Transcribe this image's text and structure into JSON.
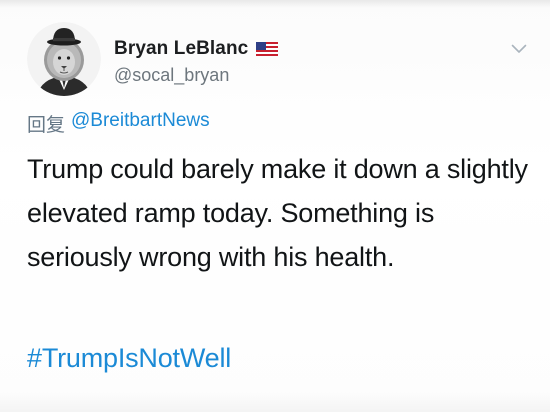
{
  "tweet": {
    "display_name": "Bryan LeBlanc",
    "handle": "@socal_bryan",
    "reply_prefix": "回复",
    "reply_to": "@BreitbartNews",
    "text": "Trump could barely make it down a slightly elevated ramp today. Something is seriously wrong with his health.",
    "hashtag": "#TrumpIsNotWell"
  },
  "icons": {
    "avatar": "lion-in-bowler-hat-avatar",
    "flag": "us-flag-icon",
    "menu": "chevron-down-icon"
  },
  "colors": {
    "link": "#1b8ad6",
    "secondary_text": "#6d767d",
    "primary_text": "#111416"
  }
}
